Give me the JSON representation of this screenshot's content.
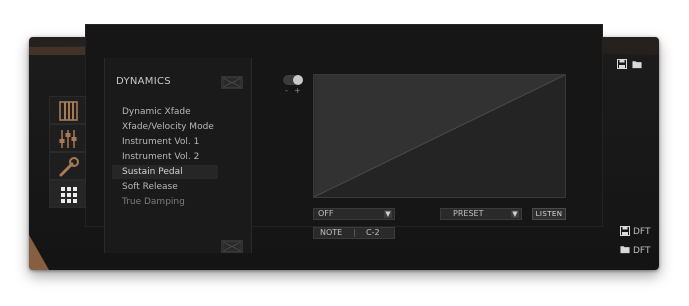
{
  "panel": {
    "title": "DYNAMICS",
    "menu": [
      {
        "label": "Dynamic Xfade",
        "state": "normal"
      },
      {
        "label": "Xfade/Velocity Mode",
        "state": "normal"
      },
      {
        "label": "Instrument Vol. 1",
        "state": "normal"
      },
      {
        "label": "Instrument Vol. 2",
        "state": "normal"
      },
      {
        "label": "Sustain Pedal",
        "state": "selected"
      },
      {
        "label": "Soft Release",
        "state": "normal"
      },
      {
        "label": "True Damping",
        "state": "dim"
      }
    ],
    "tabs": [
      {
        "icon": "piano-keys-icon"
      },
      {
        "icon": "mixer-sliders-icon"
      },
      {
        "icon": "wrench-icon"
      },
      {
        "icon": "grid-icon"
      }
    ]
  },
  "toggle": {
    "minus_label": "-",
    "plus_label": "+"
  },
  "controls": {
    "mode_value": "OFF",
    "preset_value": "PRESET",
    "listen_label": "LISTEN",
    "note_label": "NOTE",
    "note_value": "C-2",
    "dropdown_arrow": "▼"
  },
  "corner": {
    "dft_top": "DFT",
    "dft_bottom": "DFT",
    "save_icon": "floppy-disk-icon",
    "load_icon": "folder-icon"
  },
  "colors": {
    "accent": "#9a6b4a",
    "panel": "#171717",
    "graph_bg": "#2b2b2b"
  }
}
